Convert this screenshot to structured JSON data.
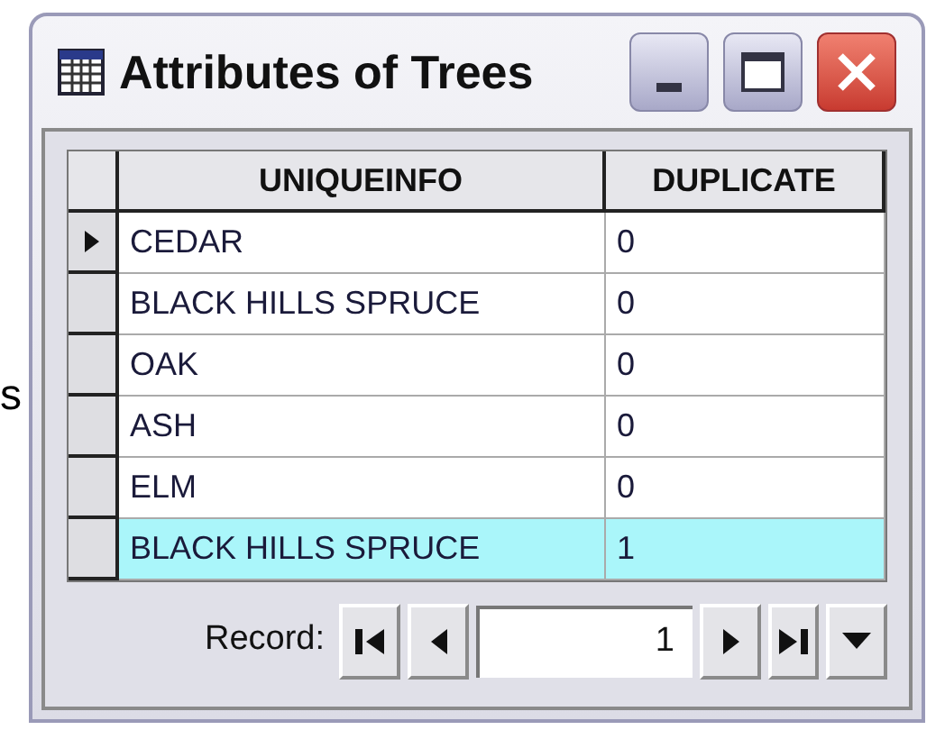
{
  "edge_text": "s",
  "window": {
    "title": "Attributes of Trees"
  },
  "table": {
    "columns": [
      "UNIQUEINFO",
      "DUPLICATE"
    ],
    "rows": [
      {
        "cells": [
          "CEDAR",
          "0"
        ],
        "current": true,
        "selected": false
      },
      {
        "cells": [
          "BLACK HILLS SPRUCE",
          "0"
        ],
        "current": false,
        "selected": false
      },
      {
        "cells": [
          "OAK",
          "0"
        ],
        "current": false,
        "selected": false
      },
      {
        "cells": [
          "ASH",
          "0"
        ],
        "current": false,
        "selected": false
      },
      {
        "cells": [
          "ELM",
          "0"
        ],
        "current": false,
        "selected": false
      },
      {
        "cells": [
          "BLACK HILLS SPRUCE",
          "1"
        ],
        "current": false,
        "selected": true
      }
    ]
  },
  "navigator": {
    "label": "Record:",
    "value": "1"
  }
}
